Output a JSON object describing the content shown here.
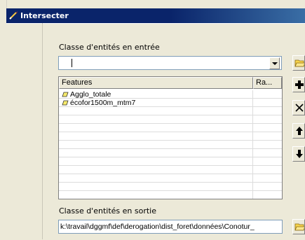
{
  "window": {
    "title": "Intersecter"
  },
  "input_section": {
    "label": "Classe d'entités en entrée",
    "value": ""
  },
  "features_table": {
    "columns": [
      "Features",
      "Ra..."
    ],
    "rows": [
      {
        "name": "Agglo_totale",
        "rank": ""
      },
      {
        "name": "écofor1500m_mtm7",
        "rank": ""
      }
    ]
  },
  "output_section": {
    "label": "Classe d'entités en sortie",
    "value": "k:\\travail\\dggmf\\def\\derogation\\dist_foret\\données\\Conotur_"
  },
  "icons": {
    "title": "pencil-icon",
    "layer": "polygon-layer-icon",
    "open_input": "open-folder-icon",
    "add": "plus-icon",
    "remove": "x-icon",
    "move_up": "arrow-up-icon",
    "move_down": "arrow-down-icon",
    "open_output": "open-folder-icon"
  },
  "colors": {
    "title_bar": "#0a246a",
    "dialog_bg": "#ece9d8",
    "layer_icon": "#f5e96a"
  }
}
